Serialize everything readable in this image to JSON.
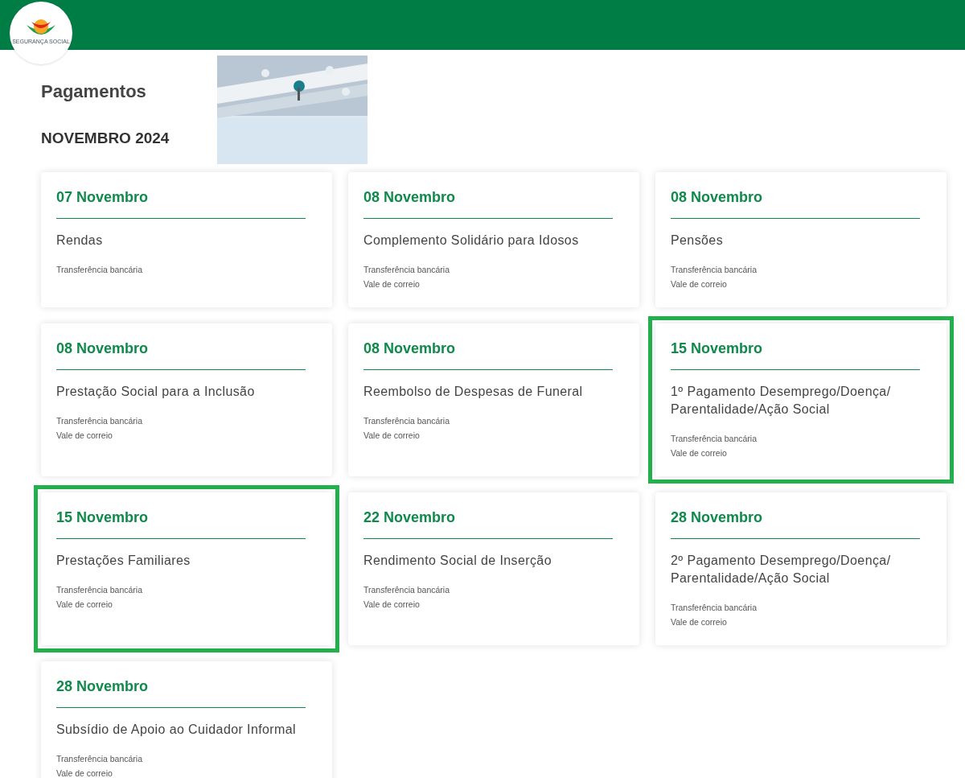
{
  "header": {
    "logo_text": "SEGURANÇA SOCIAL"
  },
  "title": "Pagamentos",
  "month": "NOVEMBRO 2024",
  "cards": [
    {
      "date": "07 Novembro",
      "title": "Rendas",
      "methods": [
        "Transferência bancária"
      ],
      "highlighted": false
    },
    {
      "date": "08 Novembro",
      "title": "Complemento Solidário para Idosos",
      "methods": [
        "Transferência bancária",
        "Vale de correio"
      ],
      "highlighted": false
    },
    {
      "date": "08 Novembro",
      "title": "Pensões",
      "methods": [
        "Transferência bancária",
        "Vale de correio"
      ],
      "highlighted": false
    },
    {
      "date": "08 Novembro",
      "title": "Prestação Social para a Inclusão",
      "methods": [
        "Transferência bancária",
        "Vale de correio"
      ],
      "highlighted": false
    },
    {
      "date": "08 Novembro",
      "title": "Reembolso de Despesas de Funeral",
      "methods": [
        "Transferência bancária",
        "Vale de correio"
      ],
      "highlighted": false
    },
    {
      "date": "15 Novembro",
      "title": "1º Pagamento Desemprego/Doença/ Parentalidade/Ação Social",
      "methods": [
        "Transferência bancária",
        "Vale de correio"
      ],
      "highlighted": true
    },
    {
      "date": "15 Novembro",
      "title": "Prestações Familiares",
      "methods": [
        "Transferência bancária",
        "Vale de correio"
      ],
      "highlighted": true
    },
    {
      "date": "22 Novembro",
      "title": "Rendimento Social de Inserção",
      "methods": [
        "Transferência bancária",
        "Vale de correio"
      ],
      "highlighted": false
    },
    {
      "date": "28 Novembro",
      "title": "2º Pagamento Desemprego/Doença/ Parentalidade/Ação Social",
      "methods": [
        "Transferência bancária",
        "Vale de correio"
      ],
      "highlighted": false
    },
    {
      "date": "28 Novembro",
      "title": "Subsídio de Apoio ao Cuidador Informal",
      "methods": [
        "Transferência bancária",
        "Vale de correio"
      ],
      "highlighted": false
    }
  ]
}
